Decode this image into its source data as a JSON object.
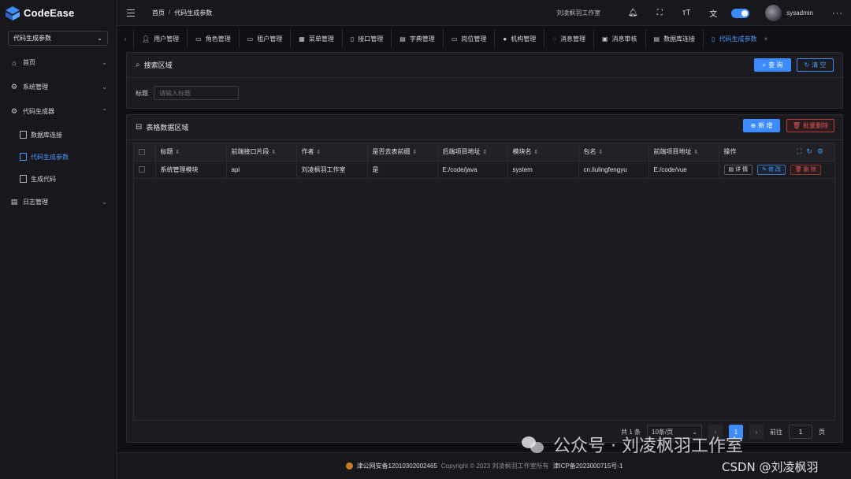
{
  "app": {
    "name": "CodeEase"
  },
  "sidebar": {
    "selector_value": "代码生成参数",
    "menu": [
      {
        "label": "首页",
        "icon": "home-icon"
      },
      {
        "label": "系统管理",
        "icon": "gear-icon"
      },
      {
        "label": "代码生成器",
        "icon": "gear-icon"
      }
    ],
    "submenu": [
      {
        "label": "数据库连接"
      },
      {
        "label": "代码生成参数"
      },
      {
        "label": "生成代码"
      }
    ],
    "log_menu": {
      "label": "日志管理"
    }
  },
  "header": {
    "breadcrumb_home": "首页",
    "breadcrumb_sep": "/",
    "breadcrumb_current": "代码生成参数",
    "studio": "刘凌枫羽工作室",
    "username": "sysadmin"
  },
  "tabs": [
    {
      "label": "用户管理",
      "icon": "user-icon"
    },
    {
      "label": "角色管理",
      "icon": "role-icon"
    },
    {
      "label": "租户管理",
      "icon": "tenant-icon"
    },
    {
      "label": "菜单管理",
      "icon": "menu-icon"
    },
    {
      "label": "接口管理",
      "icon": "api-icon"
    },
    {
      "label": "字典管理",
      "icon": "dictionary-icon"
    },
    {
      "label": "岗位管理",
      "icon": "position-icon"
    },
    {
      "label": "机构管理",
      "icon": "org-icon"
    },
    {
      "label": "消息管理",
      "icon": "message-icon"
    },
    {
      "label": "消息审核",
      "icon": "review-icon"
    },
    {
      "label": "数据库连接",
      "icon": "database-icon"
    },
    {
      "label": "代码生成参数",
      "icon": "document-icon",
      "active": true
    }
  ],
  "search_panel": {
    "title": "搜索区域",
    "query_label": "查 询",
    "clear_label": "清 空",
    "field_label": "标题",
    "field_placeholder": "请输入标题",
    "field_value": ""
  },
  "table_panel": {
    "title": "表格数据区域",
    "add_label": "新 增",
    "batch_delete_label": "批量删除",
    "columns": [
      "标题",
      "前端接口片段",
      "作者",
      "是否去表前缀",
      "后端项目地址",
      "模块名",
      "包名",
      "前端项目地址",
      "操作"
    ],
    "rows": [
      {
        "title": "系统管理模块",
        "api_segment": "api",
        "author": "刘凌枫羽工作室",
        "strip_prefix": "是",
        "backend_path": "E:/code/java",
        "module": "system",
        "package": "cn.liulingfengyu",
        "frontend_path": "E:/code/vue"
      }
    ],
    "row_actions": {
      "detail": "详 情",
      "edit": "修 改",
      "delete": "删 除"
    }
  },
  "pagination": {
    "total_prefix": "共",
    "total": "1",
    "total_suffix": "条",
    "page_size": "10条/页",
    "current_page": "1",
    "goto_prefix": "前往",
    "goto_value": "1",
    "goto_suffix": "页"
  },
  "footer": {
    "police_record": "津公网安备12010302002465",
    "copyright": "Copyright © 2023 刘凌枫羽工作室所有",
    "icp": "津ICP备2023000715号-1"
  },
  "watermark": {
    "wechat": "公众号 · 刘凌枫羽工作室",
    "csdn": "CSDN @刘凌枫羽"
  },
  "colors": {
    "accent": "#3d8cff",
    "danger": "#e05555",
    "background": "#101014",
    "panel": "#1c1c20"
  }
}
